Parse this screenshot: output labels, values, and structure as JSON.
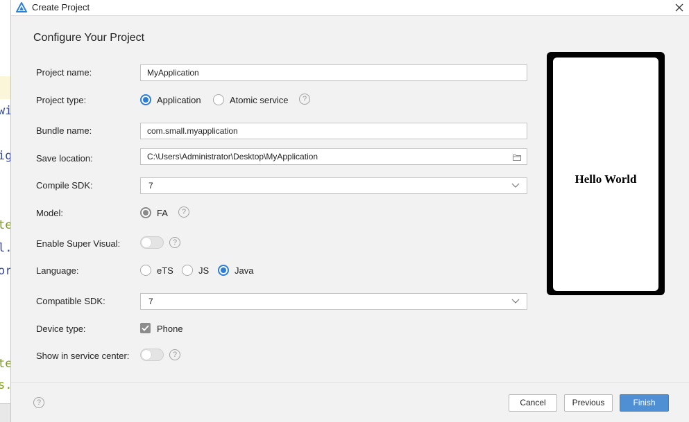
{
  "window": {
    "title": "Create Project"
  },
  "page": {
    "heading": "Configure Your Project"
  },
  "background_code": [
    {
      "text": "wi",
      "color": "blue"
    },
    {
      "text": "ig",
      "color": "blue"
    },
    {
      "text": "te",
      "color": "green"
    },
    {
      "text": "l.",
      "color": "blue"
    },
    {
      "text": "or",
      "color": "blue"
    },
    {
      "text": "te",
      "color": "green"
    },
    {
      "text": "s.",
      "color": "green"
    }
  ],
  "form": {
    "project_name": {
      "label": "Project name:",
      "value": "MyApplication"
    },
    "project_type": {
      "label": "Project type:",
      "options": [
        "Application",
        "Atomic service"
      ],
      "selected": "Application"
    },
    "bundle_name": {
      "label": "Bundle name:",
      "value": "com.small.myapplication"
    },
    "save_location": {
      "label": "Save location:",
      "value": "C:\\Users\\Administrator\\Desktop\\MyApplication"
    },
    "compile_sdk": {
      "label": "Compile SDK:",
      "value": "7"
    },
    "model": {
      "label": "Model:",
      "options": [
        "FA"
      ],
      "selected": "FA"
    },
    "enable_super_visual": {
      "label": "Enable Super Visual:",
      "on": false
    },
    "language": {
      "label": "Language:",
      "options": [
        "eTS",
        "JS",
        "Java"
      ],
      "selected": "Java"
    },
    "compatible_sdk": {
      "label": "Compatible SDK:",
      "value": "7"
    },
    "device_type": {
      "label": "Device type:",
      "options": [
        "Phone"
      ],
      "checked": true
    },
    "show_in_service_center": {
      "label": "Show in service center:",
      "on": false
    }
  },
  "preview": {
    "text": "Hello World"
  },
  "help_glyph": "?",
  "buttons": {
    "cancel": "Cancel",
    "previous": "Previous",
    "finish": "Finish"
  },
  "colors": {
    "accent": "#2d7cd6",
    "primary_button": "#4f8fd4"
  }
}
